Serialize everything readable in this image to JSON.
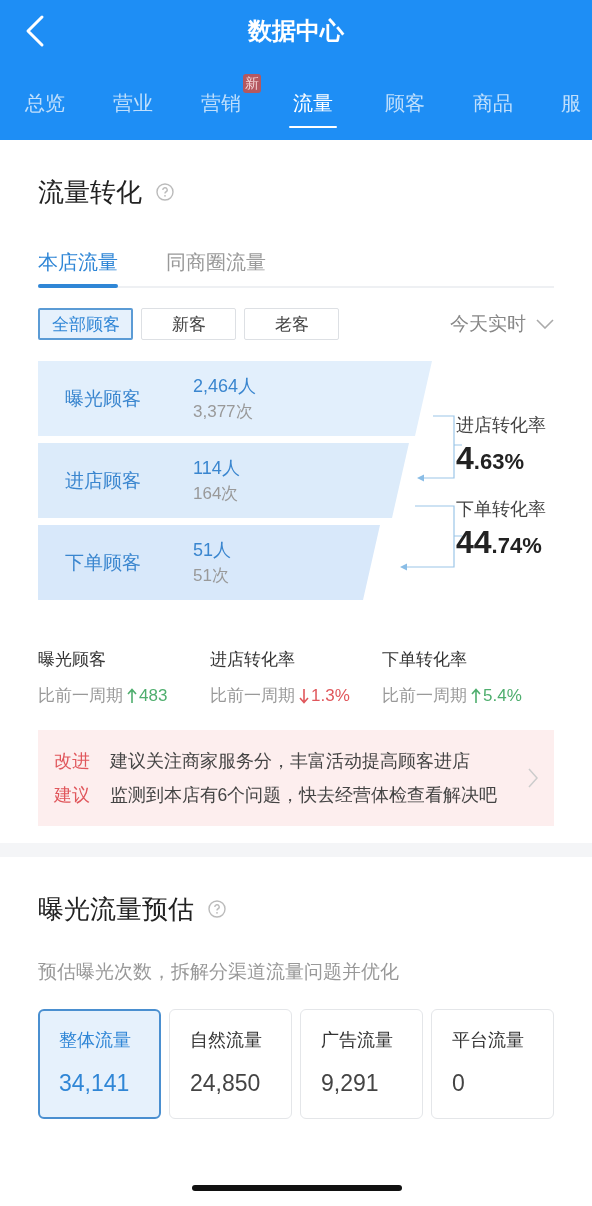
{
  "header": {
    "title": "数据中心"
  },
  "tabs": [
    {
      "label": "总览",
      "selected": false
    },
    {
      "label": "营业",
      "selected": false
    },
    {
      "label": "营销",
      "selected": false,
      "badge": "新"
    },
    {
      "label": "流量",
      "selected": true
    },
    {
      "label": "顾客",
      "selected": false
    },
    {
      "label": "商品",
      "selected": false
    },
    {
      "label": "服",
      "selected": false
    }
  ],
  "conversion": {
    "title": "流量转化",
    "subtabs": [
      {
        "label": "本店流量",
        "selected": true
      },
      {
        "label": "同商圈流量",
        "selected": false
      }
    ],
    "filters": [
      {
        "label": "全部顾客",
        "selected": true
      },
      {
        "label": "新客",
        "selected": false
      },
      {
        "label": "老客",
        "selected": false
      }
    ],
    "period": "今天实时",
    "funnel": [
      {
        "label": "曝光顾客",
        "people": "2,464人",
        "times": "3,377次"
      },
      {
        "label": "进店顾客",
        "people": "114人",
        "times": "164次"
      },
      {
        "label": "下单顾客",
        "people": "51人",
        "times": "51次"
      }
    ],
    "rates": [
      {
        "label": "进店转化率",
        "value": "4.63%"
      },
      {
        "label": "下单转化率",
        "value": "44.74%"
      }
    ],
    "comparisons": [
      {
        "label": "曝光顾客",
        "prefix": "比前一周期",
        "rising": true,
        "value": "483"
      },
      {
        "label": "进店转化率",
        "prefix": "比前一周期",
        "rising": false,
        "value": "1.3%"
      },
      {
        "label": "下单转化率",
        "prefix": "比前一周期",
        "rising": true,
        "value": "5.4%"
      }
    ],
    "suggestion": {
      "tag": "改进建议",
      "lines": [
        "建议关注商家服务分，丰富活动提高顾客进店",
        "监测到本店有6个问题，快去经营体检查看解决吧"
      ]
    }
  },
  "exposure": {
    "title": "曝光流量预估",
    "subtitle": "预估曝光次数，拆解分渠道流量问题并优化",
    "cards": [
      {
        "label": "整体流量",
        "value": "34,141",
        "selected": true
      },
      {
        "label": "自然流量",
        "value": "24,850",
        "selected": false
      },
      {
        "label": "广告流量",
        "value": "9,291",
        "selected": false
      },
      {
        "label": "平台流量",
        "value": "0",
        "selected": false
      }
    ]
  }
}
